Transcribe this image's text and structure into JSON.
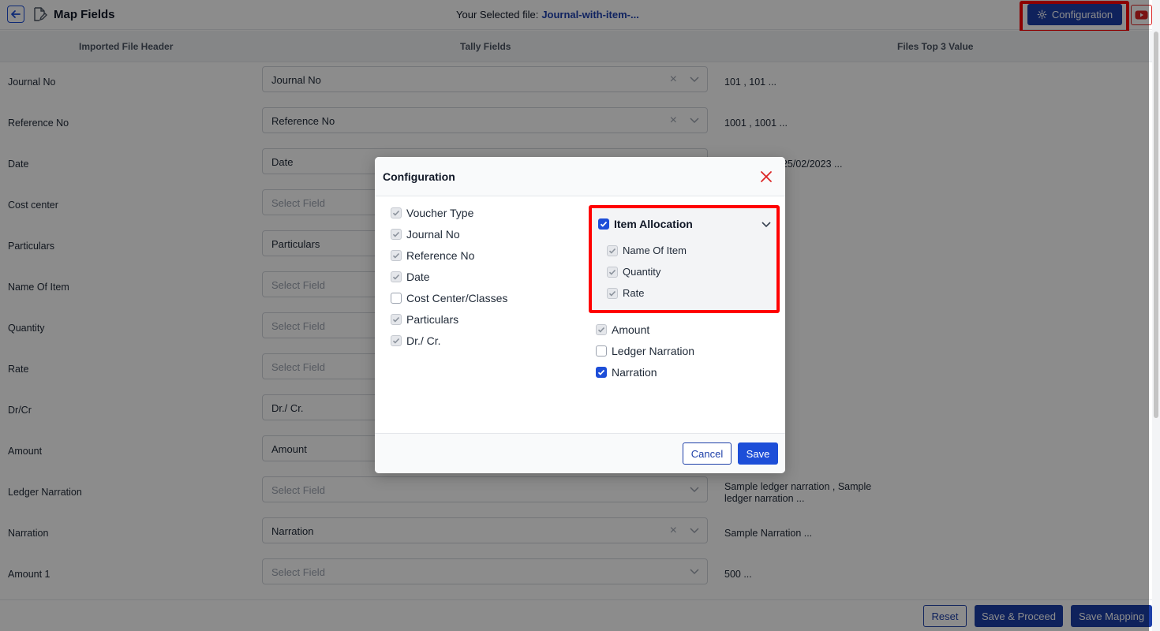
{
  "header": {
    "title": "Map Fields",
    "selected_file_label": "Your Selected file:",
    "selected_file_name": "Journal-with-item-...",
    "config_button": "Configuration"
  },
  "columns": {
    "imported": "Imported File Header",
    "tally": "Tally Fields",
    "top3": "Files Top 3 Value"
  },
  "rows": [
    {
      "label": "Journal No",
      "value": "Journal No",
      "placeholder": false,
      "clearable": true,
      "top3": "101 , 101 ..."
    },
    {
      "label": "Reference No",
      "value": "Reference No",
      "placeholder": false,
      "clearable": true,
      "top3": "1001 , 1001 ..."
    },
    {
      "label": "Date",
      "value": "Date",
      "placeholder": false,
      "clearable": true,
      "top3": "25/02/2023 , 25/02/2023 ..."
    },
    {
      "label": "Cost center",
      "value": "Select Field",
      "placeholder": true,
      "clearable": false,
      "top3": ""
    },
    {
      "label": "Particulars",
      "value": "Particulars",
      "placeholder": false,
      "clearable": true,
      "top3": ""
    },
    {
      "label": "Name Of Item",
      "value": "Select Field",
      "placeholder": true,
      "clearable": false,
      "top3": ""
    },
    {
      "label": "Quantity",
      "value": "Select Field",
      "placeholder": true,
      "clearable": false,
      "top3": ""
    },
    {
      "label": "Rate",
      "value": "Select Field",
      "placeholder": true,
      "clearable": false,
      "top3": ""
    },
    {
      "label": "Dr/Cr",
      "value": "Dr./ Cr.",
      "placeholder": false,
      "clearable": true,
      "top3": ""
    },
    {
      "label": "Amount",
      "value": "Amount",
      "placeholder": false,
      "clearable": true,
      "top3": "..."
    },
    {
      "label": "Ledger Narration",
      "value": "Select Field",
      "placeholder": true,
      "clearable": false,
      "top3": "Sample ledger narration , Sample ledger narration ..."
    },
    {
      "label": "Narration",
      "value": "Narration",
      "placeholder": false,
      "clearable": true,
      "top3": "Sample Narration ..."
    },
    {
      "label": "Amount 1",
      "value": "Select Field",
      "placeholder": true,
      "clearable": false,
      "top3": "500 ..."
    }
  ],
  "footer": {
    "reset": "Reset",
    "save_proceed": "Save & Proceed",
    "save_mapping": "Save Mapping"
  },
  "modal": {
    "title": "Configuration",
    "left_options": [
      {
        "label": "Voucher Type",
        "state": "disabled"
      },
      {
        "label": "Journal No",
        "state": "disabled"
      },
      {
        "label": "Reference No",
        "state": "disabled"
      },
      {
        "label": "Date",
        "state": "disabled"
      },
      {
        "label": "Cost Center/Classes",
        "state": "unchecked"
      },
      {
        "label": "Particulars",
        "state": "disabled"
      },
      {
        "label": "Dr./ Cr.",
        "state": "disabled"
      }
    ],
    "item_allocation": {
      "label": "Item Allocation",
      "state": "checked",
      "sub_options": [
        {
          "label": "Name Of Item",
          "state": "disabled"
        },
        {
          "label": "Quantity",
          "state": "disabled"
        },
        {
          "label": "Rate",
          "state": "disabled"
        }
      ]
    },
    "right_options": [
      {
        "label": "Amount",
        "state": "disabled"
      },
      {
        "label": "Ledger Narration",
        "state": "unchecked"
      },
      {
        "label": "Narration",
        "state": "checked"
      }
    ],
    "cancel": "Cancel",
    "save": "Save"
  },
  "colors": {
    "primary": "#1d3fa8",
    "highlight": "#ff0000",
    "close": "#dc2626"
  }
}
